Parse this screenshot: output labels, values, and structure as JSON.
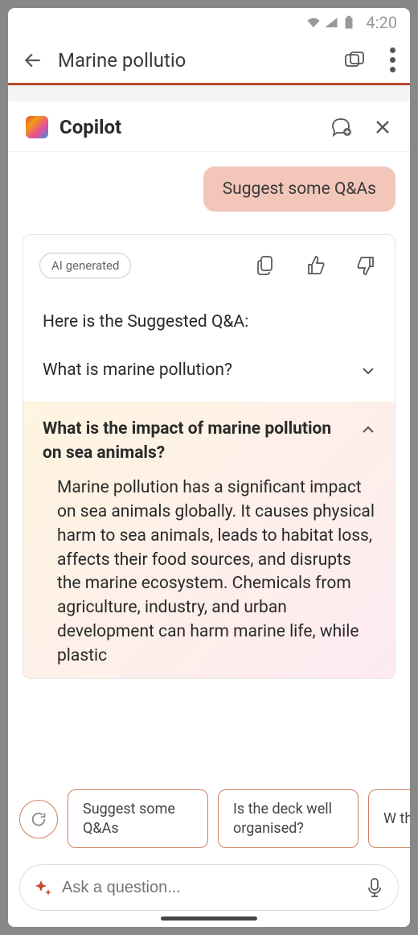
{
  "statusBar": {
    "time": "4:20"
  },
  "header": {
    "title": "Marine pollutio"
  },
  "copilot": {
    "title": "Copilot",
    "userMessage": "Suggest some Q&As",
    "aiTag": "AI generated",
    "intro": "Here is the Suggested Q&A:",
    "qas": [
      {
        "q": "What is marine pollution?",
        "expanded": false
      },
      {
        "q": "What is the impact of marine pollution on sea animals?",
        "expanded": true,
        "a": "Marine pollution has a significant impact on sea animals globally. It causes physical harm to sea animals, leads to habitat loss, affects their food sources, and disrupts the marine ecosystem. Chemicals from agriculture, industry, and urban development can harm marine life, while plastic"
      }
    ]
  },
  "suggestions": [
    "Suggest some Q&As",
    "Is the deck well organised?",
    "W th"
  ],
  "input": {
    "placeholder": "Ask a question..."
  }
}
